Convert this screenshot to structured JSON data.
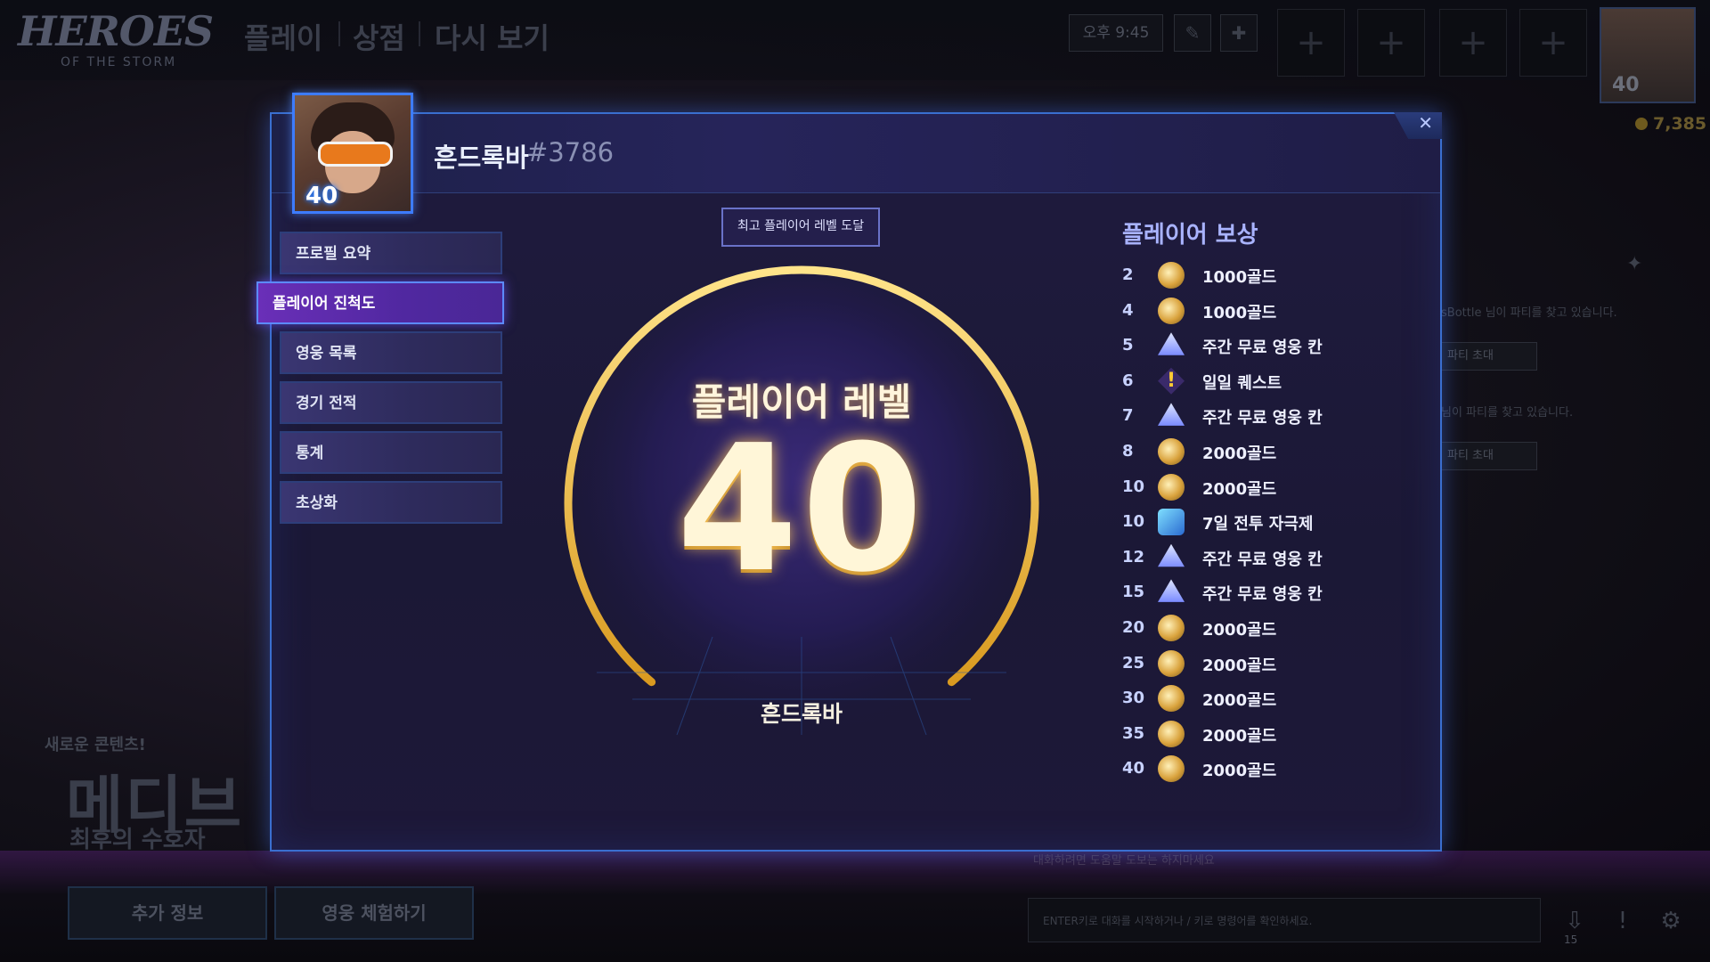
{
  "top_bar": {
    "logo_main": "HEROES",
    "logo_sub": "OF THE STORM",
    "nav": [
      "플레이",
      "상점",
      "다시 보기"
    ],
    "clock": "오후 9:45",
    "party_slot_glyph": "+",
    "portrait_level": "40",
    "gold": "7,385"
  },
  "social_panel": {
    "row1_text": "sBottle 님이 파티를 찾고 있습니다.",
    "row1_button": "파티 초대",
    "row2_text": "님이 파티를 찾고 있습니다.",
    "row2_button": "파티 초대"
  },
  "promo": {
    "new_label": "새로운 콘텐츠!",
    "title": "메디브",
    "subtitle": "최후의 수호자",
    "more_info": "추가 정보",
    "try_hero": "영웅 체험하기"
  },
  "chat": {
    "hint": "대화하려면 도움말 도보는 하지마세요",
    "input_placeholder": "ENTER키로 대화를 시작하거나 / 키로 명령어를 확인하세요.",
    "count": "15"
  },
  "modal": {
    "player_name": "흔드록바",
    "player_tag": "#3786",
    "portrait_level": "40",
    "close_glyph": "✕",
    "menu": [
      {
        "label": "프로필 요약",
        "active": false
      },
      {
        "label": "플레이어 진척도",
        "active": true
      },
      {
        "label": "영웅 목록",
        "active": false
      },
      {
        "label": "경기 전적",
        "active": false
      },
      {
        "label": "통계",
        "active": false
      },
      {
        "label": "초상화",
        "active": false
      }
    ],
    "achievement_badge": "최고 플레이어 레벨 도달",
    "level_title": "플레이어 레벨",
    "level_value": "40",
    "level_progress": 1.0,
    "level_name": "흔드록바",
    "rewards_title": "플레이어 보상",
    "rewards": [
      {
        "level": "2",
        "icon": "gold-icon",
        "text": "1000골드"
      },
      {
        "level": "4",
        "icon": "gold-icon",
        "text": "1000골드"
      },
      {
        "level": "5",
        "icon": "free-hero-icon",
        "text": "주간 무료 영웅 칸"
      },
      {
        "level": "6",
        "icon": "quest-icon",
        "text": "일일 퀘스트"
      },
      {
        "level": "7",
        "icon": "free-hero-icon",
        "text": "주간 무료 영웅 칸"
      },
      {
        "level": "8",
        "icon": "gold-icon",
        "text": "2000골드"
      },
      {
        "level": "10",
        "icon": "gold-icon",
        "text": "2000골드"
      },
      {
        "level": "10",
        "icon": "stim-pack-icon",
        "text": "7일 전투 자극제"
      },
      {
        "level": "12",
        "icon": "free-hero-icon",
        "text": "주간 무료 영웅 칸"
      },
      {
        "level": "15",
        "icon": "free-hero-icon",
        "text": "주간 무료 영웅 칸"
      },
      {
        "level": "20",
        "icon": "gold-icon",
        "text": "2000골드"
      },
      {
        "level": "25",
        "icon": "gold-icon",
        "text": "2000골드"
      },
      {
        "level": "30",
        "icon": "gold-icon",
        "text": "2000골드"
      },
      {
        "level": "35",
        "icon": "gold-icon",
        "text": "2000골드"
      },
      {
        "level": "40",
        "icon": "gold-icon",
        "text": "2000골드"
      }
    ]
  }
}
